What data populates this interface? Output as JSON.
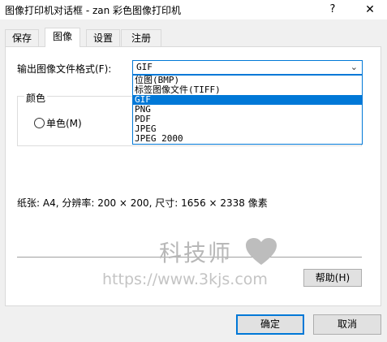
{
  "window": {
    "title": "图像打印机对话框 - zan 彩色图像打印机",
    "help_glyph": "?",
    "close_glyph": "✕"
  },
  "tabs": [
    {
      "label": "保存"
    },
    {
      "label": "图像"
    },
    {
      "label": "设置"
    },
    {
      "label": "注册"
    }
  ],
  "active_tab": "图像",
  "format": {
    "label": "输出图像文件格式(F):",
    "selected": "GIF",
    "options": [
      "位图(BMP)",
      "标签图像文件(TIFF)",
      "GIF",
      "PNG",
      "PDF",
      "JPEG",
      "JPEG 2000"
    ]
  },
  "color_group": {
    "title": "颜色",
    "radio_label": "单色(M)"
  },
  "info_text": "纸张: A4, 分辨率: 200 × 200, 尺寸: 1656 × 2338 像素",
  "buttons": {
    "help": "帮助(H)",
    "ok": "确定",
    "cancel": "取消"
  },
  "watermark": {
    "text": "科技师",
    "url": "https://www.3kjs.com"
  },
  "colors": {
    "accent": "#0078d7",
    "panel_bg": "#ffffff",
    "dialog_bg": "#f0f0f0"
  }
}
